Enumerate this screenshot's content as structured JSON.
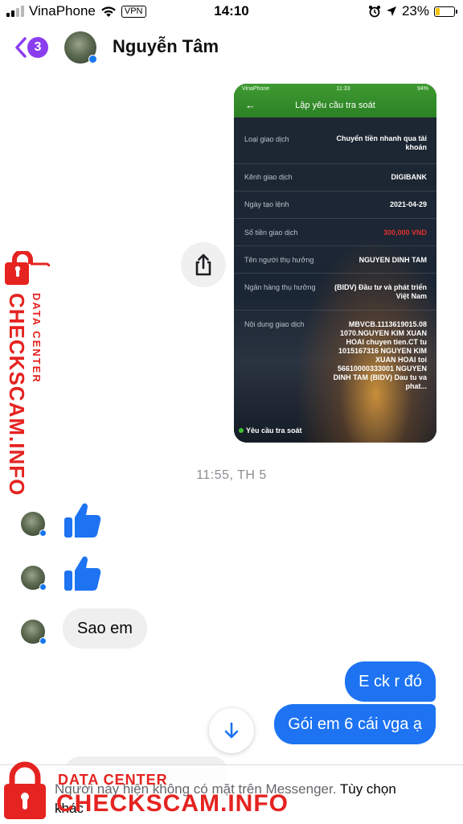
{
  "status_bar": {
    "carrier": "VinaPhone",
    "vpn": "VPN",
    "time": "14:10",
    "battery": "23%",
    "battery_level": 0.23
  },
  "header": {
    "back_count": "3",
    "contact_name": "Nguyễn Tâm"
  },
  "screenshot_message": {
    "status_carrier": "VinaPhone",
    "status_time": "11:33",
    "status_battery": "94%",
    "title": "Lập yêu cầu tra soát",
    "rows": [
      {
        "label": "Loại giao dịch",
        "value": "Chuyển tiền nhanh qua tài khoản"
      },
      {
        "label": "Kênh giao dịch",
        "value": "DIGIBANK"
      },
      {
        "label": "Ngày tạo lệnh",
        "value": "2021-04-29"
      },
      {
        "label": "Số tiền giao dịch",
        "value": "300,000 VND"
      },
      {
        "label": "Tên người thụ hưởng",
        "value": "NGUYEN DINH TAM"
      },
      {
        "label": "Ngân hàng thụ hưởng",
        "value": "(BIDV) Đầu tư và phát triển Việt Nam"
      },
      {
        "label": "Nội dung giao dịch",
        "value": "MBVCB.1113619015.08 1070.NGUYEN KIM XUAN HOAI chuyen tien.CT tu 1015167316 NGUYEN KIM XUAN HOAI toi 56610000333001 NGUYEN DINH TAM (BIDV) Dau tu va phat..."
      }
    ],
    "footer": "Yêu cầu tra soát"
  },
  "timestamp": "11:55, TH 5",
  "incoming_messages": [
    {
      "type": "like"
    },
    {
      "type": "like"
    },
    {
      "type": "text",
      "text": "Sao em"
    }
  ],
  "outgoing_messages": [
    {
      "text": "E ck r đó"
    },
    {
      "text": "Gói em 6 cái vga ạ"
    }
  ],
  "notice": {
    "text": "Người này hiện không có mặt trên Messenger.",
    "action": "Tùy chọn khác"
  },
  "watermark": {
    "sub": "DATA CENTER",
    "main": "CHECKSCAM.INFO"
  },
  "colors": {
    "accent": "#1d73f2",
    "badge": "#8b3df0",
    "watermark": "#e52320",
    "bank_green": "#2b8124"
  },
  "icons": {
    "back": "chevron-left-icon",
    "share": "share-icon",
    "like": "thumbs-up-icon",
    "scroll": "arrow-down-icon"
  }
}
